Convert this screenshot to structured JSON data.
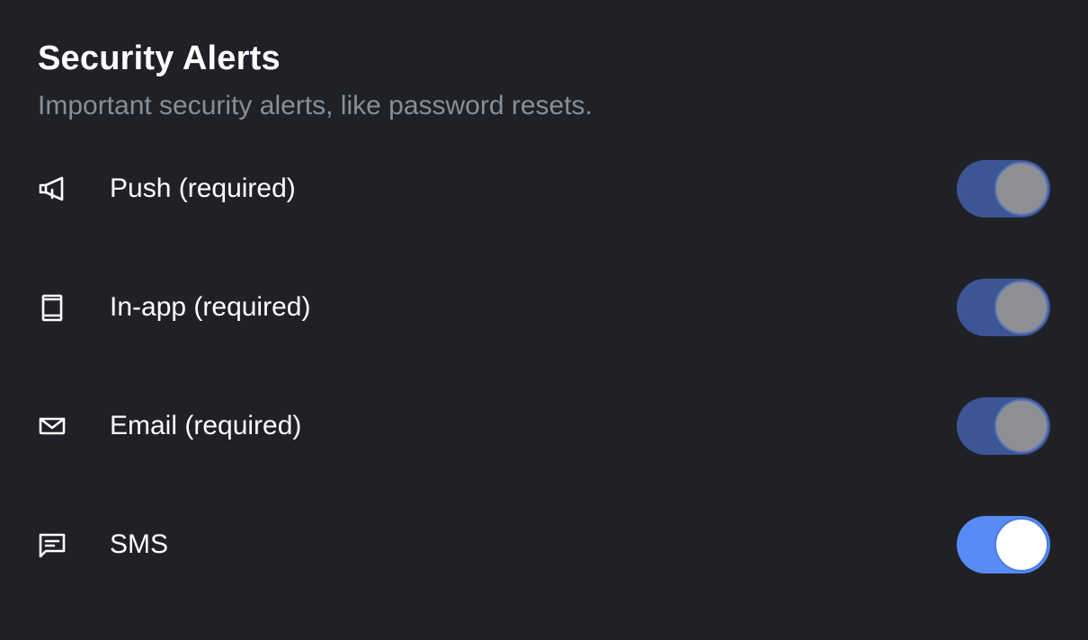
{
  "section": {
    "title": "Security Alerts",
    "subtitle": "Important security alerts, like password resets."
  },
  "channels": [
    {
      "label": "Push (required)",
      "icon": "megaphone-icon",
      "enabled": true,
      "locked": true
    },
    {
      "label": "In-app (required)",
      "icon": "phone-icon",
      "enabled": true,
      "locked": true
    },
    {
      "label": "Email (required)",
      "icon": "mail-icon",
      "enabled": true,
      "locked": true
    },
    {
      "label": "SMS",
      "icon": "message-icon",
      "enabled": true,
      "locked": false
    }
  ],
  "colors": {
    "background": "#202126",
    "subtitle": "#8a8e99",
    "toggle_locked": "#3c5594",
    "toggle_active": "#588bf6"
  }
}
